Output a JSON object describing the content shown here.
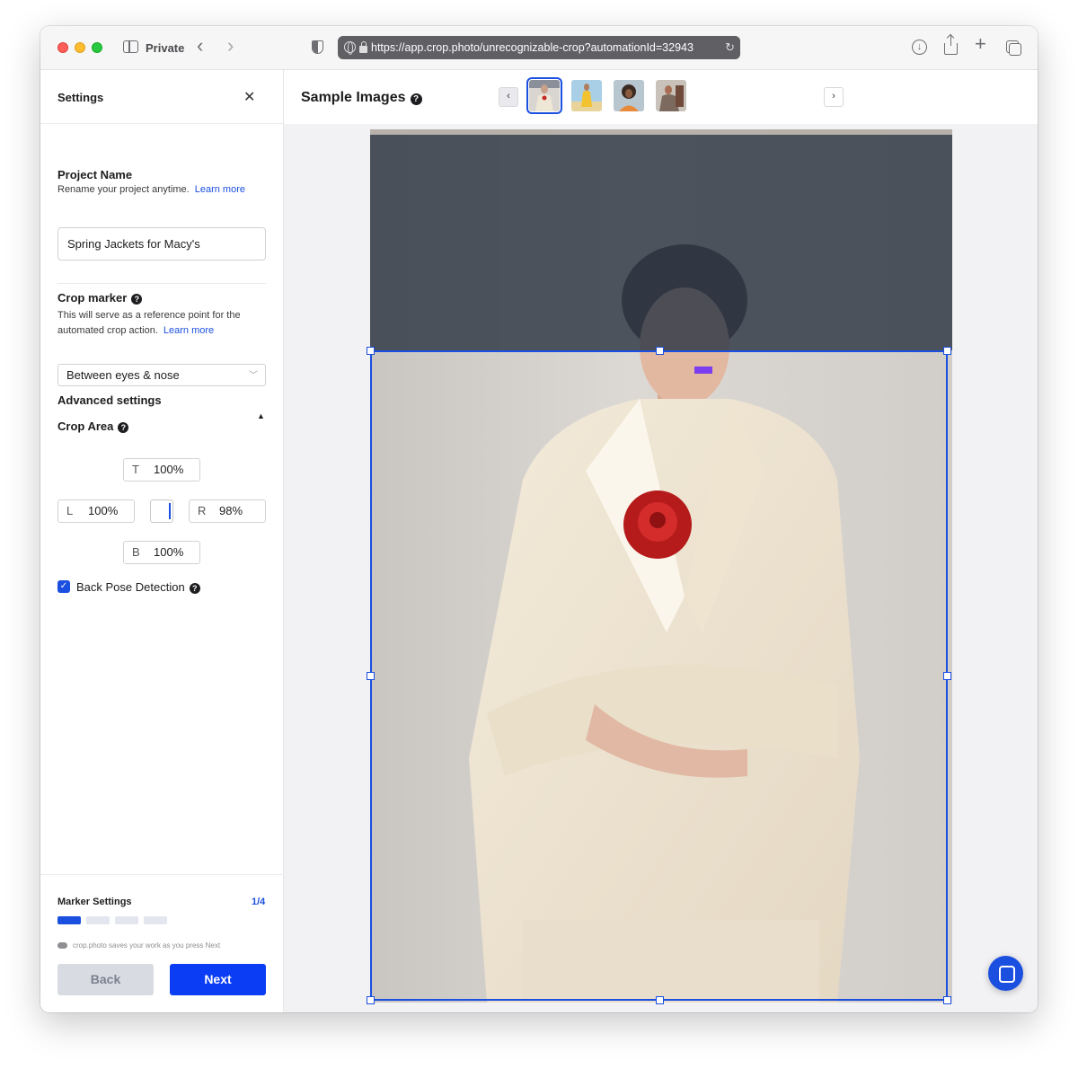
{
  "browser": {
    "mode_label": "Private",
    "url": "https://app.crop.photo/unrecognizable-crop?automationId=32943"
  },
  "settings": {
    "title": "Settings",
    "project_name": {
      "label": "Project Name",
      "description": "Rename your project anytime.",
      "link": "Learn more",
      "value": "Spring Jackets for Macy's"
    },
    "crop_marker": {
      "label": "Crop marker",
      "description_line1": "This will serve as a reference point for the",
      "description_line2": "automated crop action.",
      "link": "Learn more",
      "selected": "Between eyes & nose"
    },
    "advanced": {
      "label": "Advanced settings",
      "crop_area_label": "Crop Area",
      "top": {
        "prefix": "T",
        "value": "100%"
      },
      "left": {
        "prefix": "L",
        "value": "100%"
      },
      "right": {
        "prefix": "R",
        "value": "98%"
      },
      "bottom": {
        "prefix": "B",
        "value": "100%"
      },
      "back_pose_label": "Back Pose Detection",
      "back_pose_checked": true
    },
    "footer": {
      "marker_settings_label": "Marker Settings",
      "step": "1/4",
      "save_note": "crop.photo saves your work as you press Next",
      "back_label": "Back",
      "next_label": "Next"
    }
  },
  "main": {
    "sample_images_title": "Sample Images",
    "thumbnails": [
      {
        "name": "woman in cream suit with rose",
        "selected": true
      },
      {
        "name": "model in yellow outfit",
        "selected": false
      },
      {
        "name": "woman with curly hair in orange top",
        "selected": false
      },
      {
        "name": "woman in patterned outfit",
        "selected": false
      }
    ]
  },
  "colors": {
    "accent": "#1b4fe0",
    "next_button": "#0b3df5",
    "marker": "#7b3df0"
  }
}
